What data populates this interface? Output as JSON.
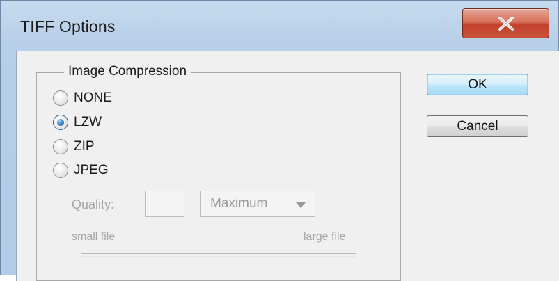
{
  "window": {
    "title": "TIFF Options",
    "close_icon": "close-x-icon"
  },
  "compression": {
    "group_label": "Image Compression",
    "options": [
      {
        "label": "NONE",
        "checked": false
      },
      {
        "label": "LZW",
        "checked": true
      },
      {
        "label": "ZIP",
        "checked": false
      },
      {
        "label": "JPEG",
        "checked": false
      }
    ]
  },
  "quality": {
    "label": "Quality:",
    "value": "",
    "preset": "Maximum",
    "small_label": "small file",
    "large_label": "large file",
    "disabled": true
  },
  "buttons": {
    "ok": "OK",
    "cancel": "Cancel"
  },
  "colors": {
    "titlebar": "#b7cfe8",
    "close_button": "#c9513a",
    "dialog_bg": "#f0f0f0",
    "disabled_text": "#a6a6a6",
    "default_button_border": "#3c7fb1"
  }
}
